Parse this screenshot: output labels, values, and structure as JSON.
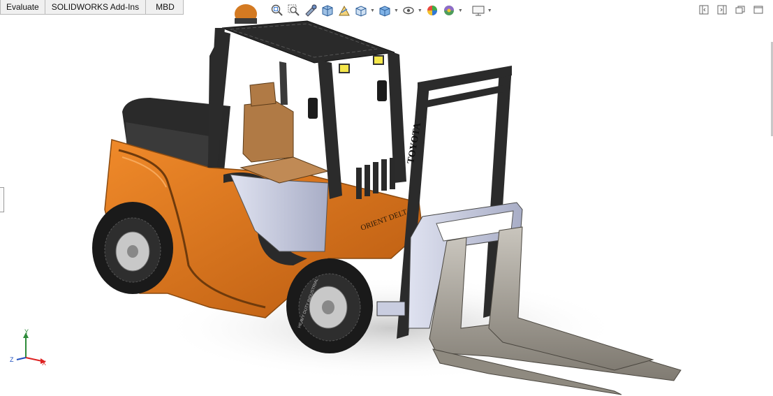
{
  "tabs": [
    {
      "label": "Evaluate"
    },
    {
      "label": "SOLIDWORKS Add-Ins"
    },
    {
      "label": "MBD"
    }
  ],
  "heads_up_toolbar": [
    {
      "icon": "zoom-to-fit-icon"
    },
    {
      "icon": "zoom-to-area-icon"
    },
    {
      "icon": "previous-view-icon"
    },
    {
      "icon": "section-view-icon"
    },
    {
      "icon": "dynamic-annotation-views-icon"
    },
    {
      "icon": "view-orientation-icon",
      "dropdown": true
    },
    {
      "icon": "display-style-icon",
      "dropdown": true
    },
    {
      "icon": "hide-show-items-icon",
      "dropdown": true
    },
    {
      "icon": "edit-appearance-icon"
    },
    {
      "icon": "apply-scene-icon",
      "dropdown": true
    },
    {
      "icon": "view-settings-icon",
      "dropdown": true
    }
  ],
  "window_controls": [
    "tile-left-icon",
    "tile-right-icon",
    "restore-icon",
    "maximize-icon"
  ],
  "model": {
    "cab_brand": "TOYOTA",
    "body_text": "ORIENT DELTA",
    "tire_text": "HEAVY DUTY INDUSTRIAL",
    "colors": {
      "body": "#e07a1c",
      "frame": "#2b2b2b",
      "forks": "#a8a49c",
      "carriage": "#c9cde0",
      "seat": "#b07a45",
      "beacon": "#d47a22"
    }
  },
  "triad": {
    "x": "X",
    "y": "Y",
    "z": "Z"
  }
}
